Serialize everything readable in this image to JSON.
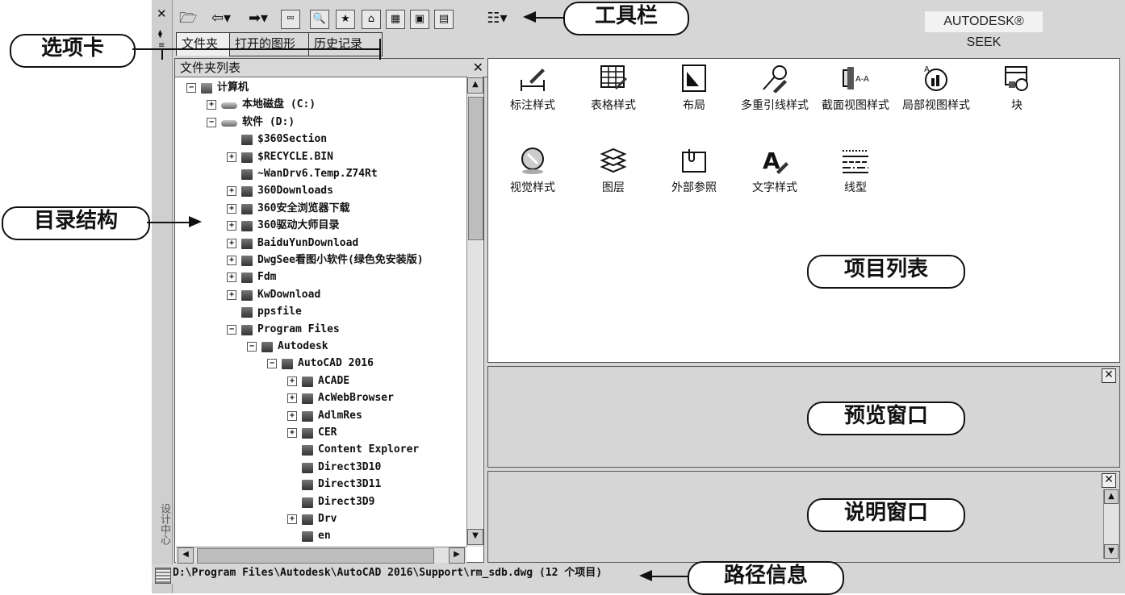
{
  "sidebar": {
    "close_symbol": "✕",
    "vertical_title": "设计中心"
  },
  "toolbar": {
    "buttons": [
      {
        "icon": "open-folder-icon",
        "glyph": "🗁"
      },
      {
        "icon": "back-icon",
        "glyph": "⇦▾"
      },
      {
        "icon": "forward-icon",
        "glyph": "➡▾"
      },
      {
        "icon": "up-icon",
        "glyph": "⮹"
      },
      {
        "icon": "search-icon",
        "glyph": "🔍"
      },
      {
        "icon": "favorites-icon",
        "glyph": "★"
      },
      {
        "icon": "home-icon",
        "glyph": "⌂"
      },
      {
        "icon": "tree-toggle-icon",
        "glyph": "▦"
      },
      {
        "icon": "preview-toggle-icon",
        "glyph": "▣"
      },
      {
        "icon": "description-toggle-icon",
        "glyph": "▤"
      },
      {
        "icon": "views-icon",
        "glyph": "☷▾"
      }
    ],
    "brand": "AUTODESK® SEEK"
  },
  "tabs": [
    "文件夹",
    "打开的图形",
    "历史记录"
  ],
  "tree": {
    "header": "文件夹列表",
    "close_symbol": "✕",
    "rows": [
      {
        "label": "计算机",
        "expander": "−",
        "indent": 0,
        "kind": "computer"
      },
      {
        "label": "本地磁盘 (C:)",
        "expander": "+",
        "indent": 1,
        "kind": "drive"
      },
      {
        "label": "软件 (D:)",
        "expander": "−",
        "indent": 1,
        "kind": "drive"
      },
      {
        "label": "$360Section",
        "expander": "",
        "indent": 2,
        "kind": "folder"
      },
      {
        "label": "$RECYCLE.BIN",
        "expander": "+",
        "indent": 2,
        "kind": "folder"
      },
      {
        "label": "~WanDrv6.Temp.Z74Rt",
        "expander": "",
        "indent": 2,
        "kind": "folder"
      },
      {
        "label": "360Downloads",
        "expander": "+",
        "indent": 2,
        "kind": "folder"
      },
      {
        "label": "360安全浏览器下载",
        "expander": "+",
        "indent": 2,
        "kind": "folder"
      },
      {
        "label": "360驱动大师目录",
        "expander": "+",
        "indent": 2,
        "kind": "folder"
      },
      {
        "label": "BaiduYunDownload",
        "expander": "+",
        "indent": 2,
        "kind": "folder"
      },
      {
        "label": "DwgSee看图小软件(绿色免安装版)",
        "expander": "+",
        "indent": 2,
        "kind": "folder"
      },
      {
        "label": "Fdm",
        "expander": "+",
        "indent": 2,
        "kind": "folder"
      },
      {
        "label": "KwDownload",
        "expander": "+",
        "indent": 2,
        "kind": "folder"
      },
      {
        "label": "ppsfile",
        "expander": "",
        "indent": 2,
        "kind": "folder"
      },
      {
        "label": "Program Files",
        "expander": "−",
        "indent": 2,
        "kind": "folder"
      },
      {
        "label": "Autodesk",
        "expander": "−",
        "indent": 3,
        "kind": "folder"
      },
      {
        "label": "AutoCAD 2016",
        "expander": "−",
        "indent": 4,
        "kind": "folder"
      },
      {
        "label": "ACADE",
        "expander": "+",
        "indent": 5,
        "kind": "folder"
      },
      {
        "label": "AcWebBrowser",
        "expander": "+",
        "indent": 5,
        "kind": "folder"
      },
      {
        "label": "AdlmRes",
        "expander": "+",
        "indent": 5,
        "kind": "folder"
      },
      {
        "label": "CER",
        "expander": "+",
        "indent": 5,
        "kind": "folder"
      },
      {
        "label": "Content Explorer",
        "expander": "",
        "indent": 5,
        "kind": "folder"
      },
      {
        "label": "Direct3D10",
        "expander": "",
        "indent": 5,
        "kind": "folder"
      },
      {
        "label": "Direct3D11",
        "expander": "",
        "indent": 5,
        "kind": "folder"
      },
      {
        "label": "Direct3D9",
        "expander": "",
        "indent": 5,
        "kind": "folder"
      },
      {
        "label": "Drv",
        "expander": "+",
        "indent": 5,
        "kind": "folder"
      },
      {
        "label": "en",
        "expander": "",
        "indent": 5,
        "kind": "folder"
      }
    ]
  },
  "items": [
    {
      "label": "标注样式",
      "icon": "dimension-style-icon"
    },
    {
      "label": "表格样式",
      "icon": "table-style-icon"
    },
    {
      "label": "布局",
      "icon": "layout-icon"
    },
    {
      "label": "多重引线样式",
      "icon": "multileader-style-icon"
    },
    {
      "label": "截面视图样式",
      "icon": "section-view-style-icon"
    },
    {
      "label": "局部视图样式",
      "icon": "detail-view-style-icon"
    },
    {
      "label": "块",
      "icon": "block-icon"
    },
    {
      "label": "视觉样式",
      "icon": "visual-style-icon"
    },
    {
      "label": "图层",
      "icon": "layers-icon"
    },
    {
      "label": "外部参照",
      "icon": "xref-icon"
    },
    {
      "label": "文字样式",
      "icon": "text-style-icon"
    },
    {
      "label": "线型",
      "icon": "linetype-icon"
    }
  ],
  "panels": {
    "close_symbol": "✕"
  },
  "status": {
    "path": "D:\\Program Files\\Autodesk\\AutoCAD 2016\\Support\\rm_sdb.dwg (12 个项目)"
  },
  "callouts": {
    "toolbar": "工具栏",
    "tabs": "选项卡",
    "tree": "目录结构",
    "items": "项目列表",
    "preview": "预览窗口",
    "description": "说明窗口",
    "path": "路径信息"
  }
}
